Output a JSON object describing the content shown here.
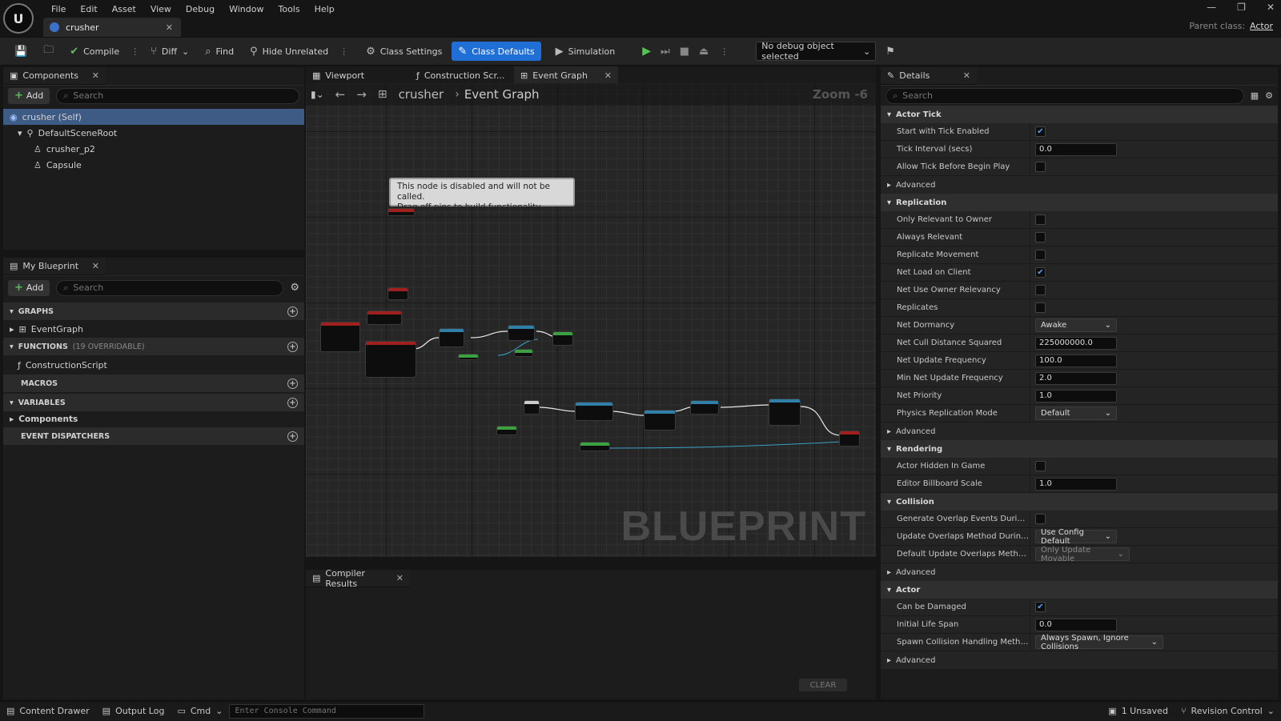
{
  "menu": [
    "File",
    "Edit",
    "Asset",
    "View",
    "Debug",
    "Window",
    "Tools",
    "Help"
  ],
  "doc_tab": {
    "title": "crusher"
  },
  "parent_class": {
    "label": "Parent class:",
    "value": "Actor"
  },
  "toolbar": {
    "compile": "Compile",
    "diff": "Diff",
    "find": "Find",
    "hide_unrelated": "Hide Unrelated",
    "class_settings": "Class Settings",
    "class_defaults": "Class Defaults",
    "simulation": "Simulation",
    "debug_object": "No debug object selected"
  },
  "components_panel": {
    "tab": "Components",
    "add": "Add",
    "search_placeholder": "Search",
    "tree": [
      "crusher (Self)",
      "DefaultSceneRoot",
      "crusher_p2",
      "Capsule"
    ]
  },
  "my_blueprint": {
    "tab": "My Blueprint",
    "add": "Add",
    "search_placeholder": "Search",
    "graphs_label": "GRAPHS",
    "event_graph": "EventGraph",
    "functions_label": "FUNCTIONS",
    "functions_count": "(19 OVERRIDABLE)",
    "construction_script": "ConstructionScript",
    "macros_label": "MACROS",
    "variables_label": "VARIABLES",
    "components_label": "Components",
    "dispatchers_label": "EVENT DISPATCHERS"
  },
  "editor_tabs": [
    "Viewport",
    "Construction Scr...",
    "Event Graph"
  ],
  "graph": {
    "crumb_root": "crusher",
    "crumb_leaf": "Event Graph",
    "zoom": "Zoom -6",
    "disabled_line1": "This node is disabled and will not be called.",
    "disabled_line2": "Drag off pins to build functionality.",
    "watermark": "BLUEPRINT"
  },
  "compiler": {
    "tab": "Compiler Results",
    "clear": "CLEAR"
  },
  "details": {
    "tab": "Details",
    "search_placeholder": "Search",
    "actor_tick": {
      "title": "Actor Tick",
      "start_tick": "Start with Tick Enabled",
      "tick_interval": "Tick Interval (secs)",
      "tick_interval_val": "0.0",
      "allow_tick": "Allow Tick Before Begin Play",
      "advanced": "Advanced"
    },
    "replication": {
      "title": "Replication",
      "only_relevant": "Only Relevant to Owner",
      "always_relevant": "Always Relevant",
      "replicate_movement": "Replicate Movement",
      "net_load": "Net Load on Client",
      "net_use_owner": "Net Use Owner Relevancy",
      "replicates": "Replicates",
      "net_dormancy": "Net Dormancy",
      "net_dormancy_val": "Awake",
      "net_cull": "Net Cull Distance Squared",
      "net_cull_val": "225000000.0",
      "net_update": "Net Update Frequency",
      "net_update_val": "100.0",
      "min_net_update": "Min Net Update Frequency",
      "min_net_update_val": "2.0",
      "net_priority": "Net Priority",
      "net_priority_val": "1.0",
      "phys_rep": "Physics Replication Mode",
      "phys_rep_val": "Default",
      "advanced": "Advanced"
    },
    "rendering": {
      "title": "Rendering",
      "hidden": "Actor Hidden In Game",
      "billboard": "Editor Billboard Scale",
      "billboard_val": "1.0"
    },
    "collision": {
      "title": "Collision",
      "gen_overlap": "Generate Overlap Events During Level S...",
      "update_overlap": "Update Overlaps Method During Level S...",
      "update_overlap_val": "Use Config Default",
      "default_update": "Default Update Overlaps Method During...",
      "default_update_val": "Only Update Movable",
      "advanced": "Advanced"
    },
    "actor": {
      "title": "Actor",
      "can_damage": "Can be Damaged",
      "life_span": "Initial Life Span",
      "life_span_val": "0.0",
      "spawn_coll": "Spawn Collision Handling Method",
      "spawn_coll_val": "Always Spawn, Ignore Collisions",
      "advanced": "Advanced"
    }
  },
  "statusbar": {
    "content_drawer": "Content Drawer",
    "output_log": "Output Log",
    "cmd": "Cmd",
    "console_placeholder": "Enter Console Command",
    "unsaved": "1 Unsaved",
    "revision": "Revision Control"
  }
}
